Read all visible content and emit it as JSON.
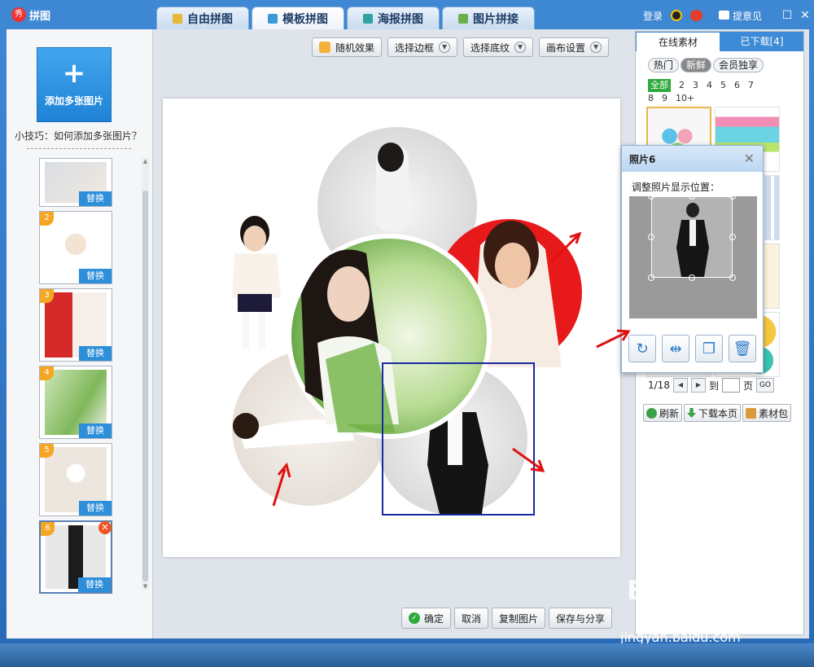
{
  "app": {
    "title": "拼图"
  },
  "tabs": [
    {
      "label": "自由拼图",
      "color": "#e7b93b"
    },
    {
      "label": "模板拼图",
      "color": "#3a9ad6"
    },
    {
      "label": "海报拼图",
      "color": "#2fa3a0"
    },
    {
      "label": "图片拼接",
      "color": "#6bb04a"
    }
  ],
  "header": {
    "login": "登录",
    "feedback": "提意见"
  },
  "left": {
    "add_button": "添加多张图片",
    "tip": "小技巧：如何添加多张图片？",
    "replace": "替换",
    "thumbs": [
      {
        "num": "",
        "colors": [
          "#d9dde3",
          "#f0e9df"
        ]
      },
      {
        "num": "2",
        "colors": [
          "#ffffff",
          "#f2e3d3"
        ]
      },
      {
        "num": "3",
        "colors": [
          "#d62a2a",
          "#f6eee8"
        ]
      },
      {
        "num": "4",
        "colors": [
          "#cfe7b8",
          "#7fb75a"
        ]
      },
      {
        "num": "5",
        "colors": [
          "#ece6df",
          "#ffffff"
        ]
      },
      {
        "num": "6",
        "colors": [
          "#e8e8e8",
          "#1c1c1c"
        ]
      }
    ]
  },
  "toolbar": {
    "random": "随机效果",
    "border": "选择边框",
    "texture": "选择底纹",
    "canvas": "画布设置"
  },
  "bottom": {
    "ok": "确定",
    "cancel": "取消",
    "copy": "复制图片",
    "save": "保存与分享"
  },
  "right": {
    "tab_online": "在线素材",
    "tab_downloaded": "已下载[4]",
    "filters": [
      "热门",
      "新鲜",
      "会员独享"
    ],
    "counts": [
      "全部",
      "2",
      "3",
      "4",
      "5",
      "6",
      "7",
      "8",
      "9",
      "10+"
    ],
    "page": "1/18",
    "goto": "到",
    "page_unit": "页",
    "go": "GO",
    "refresh": "刷新",
    "download": "下载本页",
    "pack": "素材包"
  },
  "popup": {
    "title": "照片6",
    "subtitle": "调整照片显示位置："
  },
  "watermark": {
    "brand": "Bai du 经验",
    "url": "jingyan.baidu.com"
  }
}
